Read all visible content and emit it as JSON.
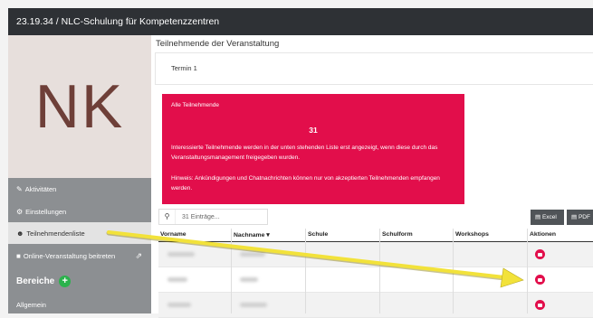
{
  "header": {
    "title": "23.19.34 / NLC-Schulung für Kompetenzzentren"
  },
  "sidebar": {
    "logo_text": "NK",
    "items": [
      {
        "label": "Aktivitäten",
        "icon": "pin-icon"
      },
      {
        "label": "Einstellungen",
        "icon": "gears-icon"
      },
      {
        "label": "Teilnehmendenliste",
        "icon": "users-icon"
      },
      {
        "label": "Online-Veranstaltung beitreten",
        "icon": "video-icon",
        "trailing_icon": "external-link-icon"
      }
    ],
    "section_title": "Bereiche",
    "section_item": "Allgemein"
  },
  "main": {
    "title": "Teilnehmende der Veranstaltung",
    "tab": "Termin 1",
    "alert": {
      "title": "Alle Teilnehmende",
      "count": "31",
      "text": "Interessierte Teilnehmende werden in der unten stehenden Liste erst angezeigt, wenn diese durch das Veranstaltungsmanagement freigegeben wurden.",
      "hint": "Hinweis: Ankündigungen und Chatnachrichten können nur von akzeptierten Teilnehmenden empfangen werden."
    },
    "search": {
      "value": "31 Einträge..."
    },
    "buttons": {
      "excel": "Excel",
      "pdf": "PDF"
    },
    "table": {
      "columns": [
        "Vorname",
        "Nachname",
        "Schule",
        "Schulform",
        "Workshops",
        "Aktionen"
      ],
      "sort_indicator": "▾"
    }
  },
  "colors": {
    "accent": "#e20e4b",
    "sidebar": "#8c8f92",
    "topbar": "#2e3135",
    "annotation_arrow": "#f2e23a"
  }
}
